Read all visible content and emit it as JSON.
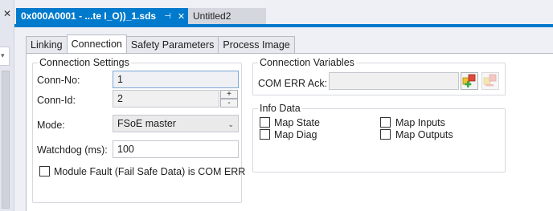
{
  "doc_tabs": [
    {
      "label": "0x000A0001 - ...te I_O))_1.sds",
      "pin_icon": "pin-icon",
      "close_icon": "close-icon"
    },
    {
      "label": "Untitled2"
    }
  ],
  "inner_tabs": [
    {
      "label": "Linking"
    },
    {
      "label": "Connection"
    },
    {
      "label": "Safety Parameters"
    },
    {
      "label": "Process Image"
    }
  ],
  "connection_settings": {
    "title": "Connection Settings",
    "conn_no_label": "Conn-No:",
    "conn_no_value": "1",
    "conn_id_label": "Conn-Id:",
    "conn_id_value": "2",
    "spin_up": "+",
    "spin_down": "-",
    "mode_label": "Mode:",
    "mode_value": "FSoE master",
    "watchdog_label": "Watchdog (ms):",
    "watchdog_value": "100",
    "module_fault_label": "Module Fault (Fail Safe Data) is COM ERR",
    "module_fault_checked": false
  },
  "connection_variables": {
    "title": "Connection Variables",
    "com_err_label": "COM ERR Ack:",
    "com_err_value": ""
  },
  "info_data": {
    "title": "Info Data",
    "items": [
      {
        "label": "Map State",
        "checked": false
      },
      {
        "label": "Map Diag",
        "checked": false
      },
      {
        "label": "Map Inputs",
        "checked": false
      },
      {
        "label": "Map Outputs",
        "checked": false
      }
    ]
  },
  "colors": {
    "accent": "#007acc",
    "panel": "#ffffff",
    "background": "#eef0f5"
  }
}
